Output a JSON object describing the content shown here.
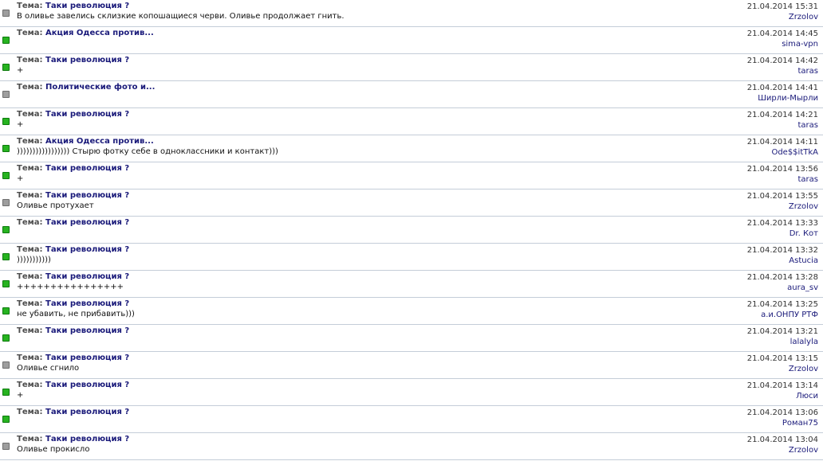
{
  "topic_prefix": "Тема:",
  "colors": {
    "green_marker": "#27b320",
    "gray_marker": "#9e9e9e",
    "link": "#1a1a7a",
    "divider": "#c4cdd8"
  },
  "posts": [
    {
      "marker": "gray",
      "topic": "Таки революция ?",
      "snippet": "В оливье завелись склизкие копошащиеся черви. Оливье продолжает гнить.",
      "date": "21.04.2014 15:31",
      "author": "Zrzolov"
    },
    {
      "marker": "green",
      "topic": "Акция Одесса против...",
      "snippet": "",
      "date": "21.04.2014 14:45",
      "author": "sima-vpn"
    },
    {
      "marker": "green",
      "topic": "Таки революция ?",
      "snippet": "+",
      "date": "21.04.2014 14:42",
      "author": "taras"
    },
    {
      "marker": "gray",
      "topic": "Политические фото и...",
      "snippet": "",
      "date": "21.04.2014 14:41",
      "author": "Ширли-Мырли"
    },
    {
      "marker": "green",
      "topic": "Таки революция ?",
      "snippet": "+",
      "date": "21.04.2014 14:21",
      "author": "taras"
    },
    {
      "marker": "green",
      "topic": "Акция Одесса против...",
      "snippet": "))))))))))))))))) Стырю фотку себе в одноклассники и контакт)))",
      "date": "21.04.2014 14:11",
      "author": "Ode$$itTkA"
    },
    {
      "marker": "green",
      "topic": "Таки революция ?",
      "snippet": "+",
      "date": "21.04.2014 13:56",
      "author": "taras"
    },
    {
      "marker": "gray",
      "topic": "Таки революция ?",
      "snippet": "Оливье протухает",
      "date": "21.04.2014 13:55",
      "author": "Zrzolov"
    },
    {
      "marker": "green",
      "topic": "Таки революция ?",
      "snippet": "",
      "date": "21.04.2014 13:33",
      "author": "Dr. Кот"
    },
    {
      "marker": "green",
      "topic": "Таки революция ?",
      "snippet": ")))))))))))",
      "date": "21.04.2014 13:32",
      "author": "Astucia"
    },
    {
      "marker": "green",
      "topic": "Таки революция ?",
      "snippet": "++++++++++++++++",
      "date": "21.04.2014 13:28",
      "author": "aura_sv"
    },
    {
      "marker": "green",
      "topic": "Таки революция ?",
      "snippet": "не убавить, не прибавить)))",
      "date": "21.04.2014 13:25",
      "author": "а.и.ОНПУ РТФ"
    },
    {
      "marker": "green",
      "topic": "Таки революция ?",
      "snippet": "",
      "date": "21.04.2014 13:21",
      "author": "lalalyla"
    },
    {
      "marker": "gray",
      "topic": "Таки революция ?",
      "snippet": "Оливье сгнило",
      "date": "21.04.2014 13:15",
      "author": "Zrzolov"
    },
    {
      "marker": "green",
      "topic": "Таки революция ?",
      "snippet": "+",
      "date": "21.04.2014 13:14",
      "author": "Люси"
    },
    {
      "marker": "green",
      "topic": "Таки революция ?",
      "snippet": "",
      "date": "21.04.2014 13:06",
      "author": "Роман75"
    },
    {
      "marker": "gray",
      "topic": "Таки революция ?",
      "snippet": "Оливье прокисло",
      "date": "21.04.2014 13:04",
      "author": "Zrzolov"
    }
  ]
}
